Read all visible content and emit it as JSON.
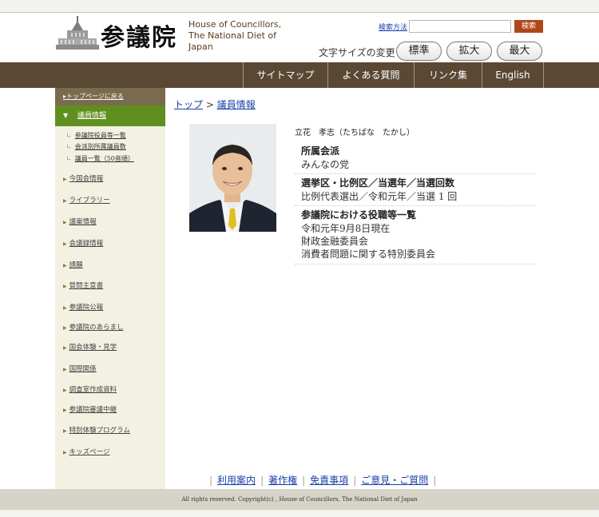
{
  "header": {
    "logo_kanji": "参議院",
    "logo_en_line1": "House of Councillors,",
    "logo_en_line2": "The National Diet of Japan",
    "search_howto": "検索方法",
    "search_placeholder": "",
    "search_button": "検索",
    "fontsize_label": "文字サイズの変更",
    "fontsize_buttons": [
      "標準",
      "拡大",
      "最大"
    ]
  },
  "nav": {
    "items": [
      "サイトマップ",
      "よくある質問",
      "リンク集",
      "English"
    ]
  },
  "sidebar": {
    "top_link": "トップページに戻る",
    "active": "議員情報",
    "sub_items": [
      "参議院役員等一覧",
      "会派別所属議員数",
      "議員一覧（50音順）"
    ],
    "items": [
      "今国会情報",
      "ライブラリー",
      "議案情報",
      "会議録情報",
      "請願",
      "質問主意書",
      "参議院公報",
      "参議院のあらまし",
      "国会体験・見学",
      "国際関係",
      "調査室作成資料",
      "参議院審議中継",
      "特別体験プログラム",
      "キッズページ"
    ]
  },
  "breadcrumb": {
    "top": "トップ",
    "sep": " > ",
    "current": "議員情報"
  },
  "member": {
    "name": "立花　孝志（たちばな　たかし）",
    "party_label": "所属会派",
    "party_value": "みんなの党",
    "district_label": "選挙区・比例区／当選年／当選回数",
    "district_value": "比例代表選出／令和元年／当選 1 回",
    "roles_label": "参議院における役職等一覧",
    "roles": [
      "令和元年9月8日現在",
      "財政金融委員会",
      "消費者問題に関する特別委員会"
    ]
  },
  "footer": {
    "links": [
      "利用案内",
      "著作権",
      "免責事項",
      "ご意見・ご質問"
    ],
    "copyright": "All rights reserved. Copyright(c) , House of Councillors, The National Diet of Japan"
  },
  "colors": {
    "nav_bg": "#5a4834",
    "sidebar_bg": "#f3f1e1",
    "active_green": "#5f8f1e",
    "search_button": "#b0471b",
    "footer_bg": "#d6d4c8"
  }
}
